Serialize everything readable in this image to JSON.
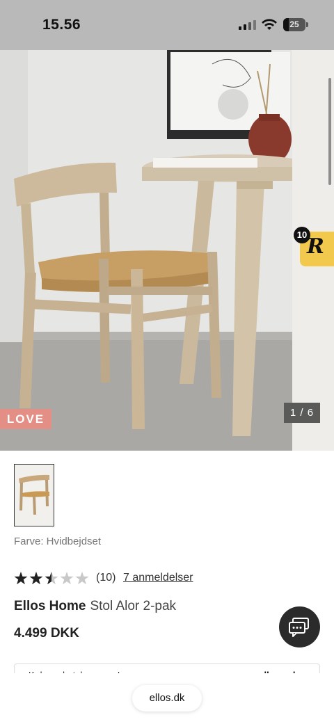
{
  "status_bar": {
    "time": "15.56",
    "battery": "25"
  },
  "gallery": {
    "badge": "LOVE",
    "counter": "1 / 6",
    "reviews_widget_count": "10",
    "reviews_widget_letter": "R"
  },
  "product": {
    "color_label": "Farve: Hvidbejdset",
    "rating": 2.5,
    "rating_max": 5,
    "rating_count": "(10)",
    "reviews_link": "7 anmeldelser",
    "brand": "Ellos Home",
    "name": "Stol Alor 2-pak",
    "price": "4.499 DKK"
  },
  "klarna": {
    "text": "Køb nu, betal senere. Læs mere",
    "logo": "ellos • elav"
  },
  "browser": {
    "url": "ellos.dk"
  },
  "colors": {
    "status_bar_bg": "#b9b9b9",
    "love_badge": "#e48f86",
    "reviews_widget": "#f2c94c",
    "chat_button": "#2b2b2b"
  },
  "icons": [
    "cellular-signal-icon",
    "wifi-icon",
    "battery-icon",
    "chat-icon",
    "star-icon"
  ]
}
